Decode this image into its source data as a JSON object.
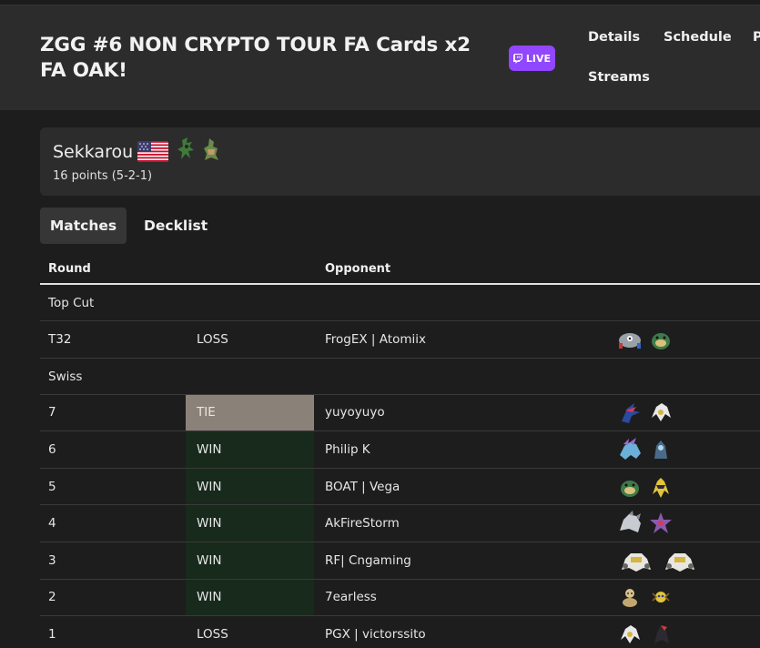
{
  "header": {
    "title": "ZGG #6 NON CRYPTO TOUR FA Cards x2 FA OAK!",
    "live_label": "LIVE",
    "nav": [
      "Details",
      "Schedule",
      "P",
      "Streams"
    ]
  },
  "player": {
    "name": "Sekkarou",
    "points": "16 points (5-2-1)",
    "flag": "us-flag-icon"
  },
  "tabs": {
    "matches": "Matches",
    "decklist": "Decklist"
  },
  "table": {
    "headers": {
      "round": "Round",
      "opponent": "Opponent"
    },
    "top_cut_label": "Top Cut",
    "swiss_label": "Swiss",
    "top_cut": [
      {
        "round": "T32",
        "result": "LOSS",
        "opponent": "FrogEX | Atomiix",
        "sprites": [
          "magnezone-icon",
          "toedscruel-icon"
        ]
      }
    ],
    "swiss": [
      {
        "round": "7",
        "result": "TIE",
        "opponent": "yuyoyuyo",
        "sprites": [
          "greninja-icon",
          "arceus-icon"
        ]
      },
      {
        "round": "6",
        "result": "WIN",
        "opponent": "Philip K",
        "sprites": [
          "suicune-icon",
          "ogerpon-icon"
        ]
      },
      {
        "round": "5",
        "result": "WIN",
        "opponent": "BOAT | Vega",
        "sprites": [
          "toedscruel-icon",
          "zeraora-icon"
        ]
      },
      {
        "round": "4",
        "result": "WIN",
        "opponent": "AkFireStorm",
        "sprites": [
          "iron-thorns-icon",
          "starmie-icon"
        ]
      },
      {
        "round": "3",
        "result": "WIN",
        "opponent": "RF| Cngaming",
        "sprites": [
          "regigigas-icon",
          "regigigas-icon"
        ]
      },
      {
        "round": "2",
        "result": "WIN",
        "opponent": "7earless",
        "sprites": [
          "bronzong-icon",
          "joltik-icon"
        ]
      },
      {
        "round": "1",
        "result": "LOSS",
        "opponent": "PGX | victorssito",
        "sprites": [
          "arceus-icon",
          "darkrai-icon"
        ]
      }
    ]
  },
  "colors": {
    "background": "#1d1d1d",
    "panel": "#2c2c2c",
    "live": "#9146ff",
    "win_cell": "#172a1c",
    "tie_cell": "#8a8278"
  }
}
